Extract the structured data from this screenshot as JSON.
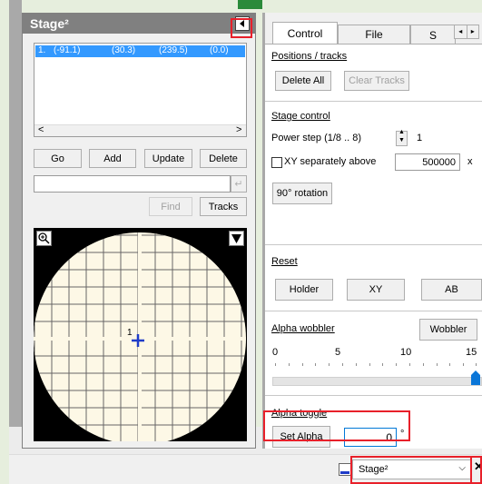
{
  "stage_window": {
    "title": "Stage²",
    "position_row": {
      "index": "1.",
      "x": "(-91.1)",
      "y": "(30.3)",
      "z": "(239.5)",
      "a": "(0.0)"
    },
    "buttons": {
      "go": "Go",
      "add": "Add",
      "update": "Update",
      "delete": "Delete",
      "find": "Find",
      "tracks": "Tracks"
    },
    "map_label": "1"
  },
  "tabs": [
    "Control",
    "File",
    "S"
  ],
  "control": {
    "positions_header": "Positions / tracks",
    "delete_all": "Delete All",
    "clear_tracks": "Clear Tracks",
    "stage_control_header": "Stage control",
    "power_step_label": "Power step (1/8 .. 8)",
    "power_step_value": "1",
    "xy_separately_label": "XY separately above",
    "xy_separately_value": "500000",
    "xy_separately_unit": "x",
    "rotation_button": "90° rotation",
    "reset_header": "Reset",
    "holder_button": "Holder",
    "xy_button": "XY",
    "ab_button": "AB",
    "alpha_wobbler_header": "Alpha wobbler",
    "wobbler_button": "Wobbler",
    "wobbler_scale": [
      "0",
      "5",
      "10",
      "15"
    ],
    "wobbler_level": 15,
    "alpha_toggle_header": "Alpha toggle",
    "set_alpha_button": "Set Alpha",
    "alpha_value": "0",
    "alpha_unit": "°"
  },
  "bottom_select": {
    "value": "Stage²"
  },
  "colors": {
    "highlight": "#e8202a",
    "selection": "#3399ff",
    "title_bar": "#808080"
  }
}
